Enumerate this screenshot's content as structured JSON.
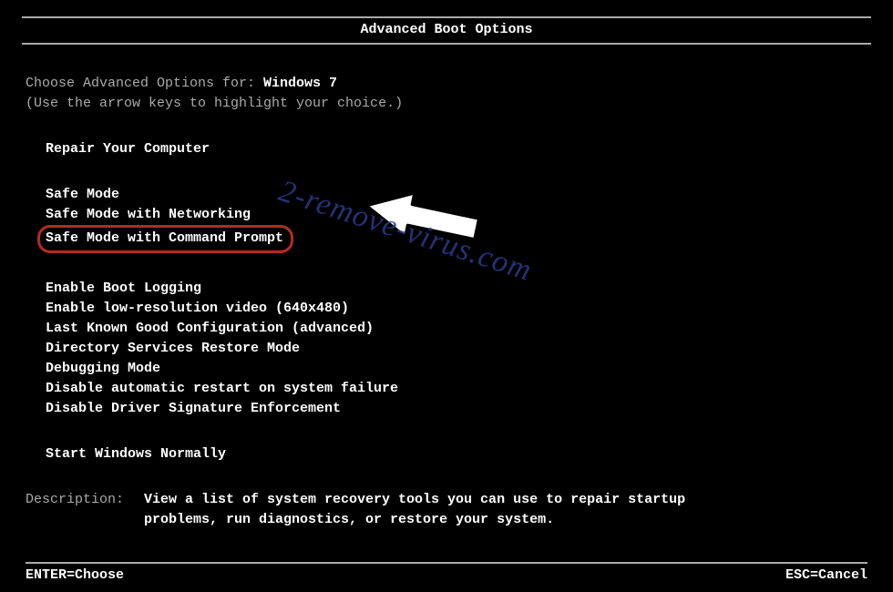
{
  "title": "Advanced Boot Options",
  "intro": {
    "prefix": "Choose Advanced Options for: ",
    "os": "Windows 7",
    "hint": "(Use the arrow keys to highlight your choice.)"
  },
  "groups": {
    "repair": [
      "Repair Your Computer"
    ],
    "safe": [
      "Safe Mode",
      "Safe Mode with Networking",
      "Safe Mode with Command Prompt"
    ],
    "advanced": [
      "Enable Boot Logging",
      "Enable low-resolution video (640x480)",
      "Last Known Good Configuration (advanced)",
      "Directory Services Restore Mode",
      "Debugging Mode",
      "Disable automatic restart on system failure",
      "Disable Driver Signature Enforcement"
    ],
    "normal": [
      "Start Windows Normally"
    ]
  },
  "highlighted": "Safe Mode with Command Prompt",
  "description": {
    "label": "Description:",
    "text": "View a list of system recovery tools you can use to repair startup problems, run diagnostics, or restore your system."
  },
  "footer": {
    "enter": "ENTER=Choose",
    "esc": "ESC=Cancel"
  },
  "watermark": "2-remove-virus.com"
}
